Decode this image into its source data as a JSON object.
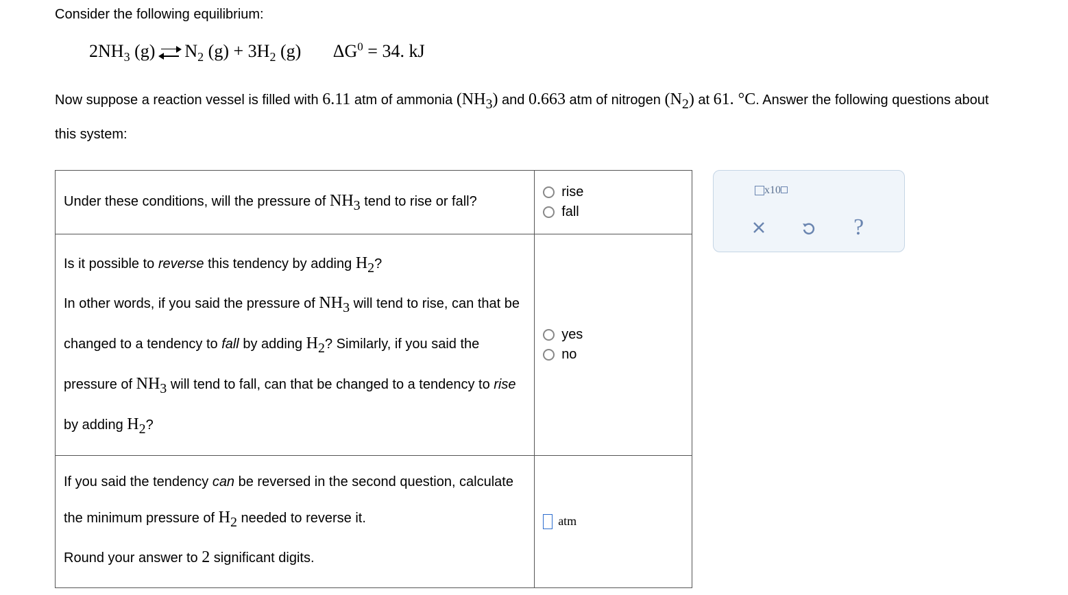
{
  "intro_text": "Consider the following equilibrium:",
  "equation": {
    "left": "2NH",
    "left_sub": "3",
    "left_state": "(g)",
    "product1": "N",
    "product1_sub": "2",
    "product1_state": "(g)",
    "plus": "+",
    "product2": "3H",
    "product2_sub": "2",
    "product2_state": "(g)",
    "delta_g_label": "ΔG",
    "delta_g_sup": "0",
    "delta_g_value": "= 34. kJ"
  },
  "problem": {
    "prefix": "Now suppose a reaction vessel is filled with ",
    "val1": "6.11",
    "text1": " atm of ammonia ",
    "species1": "(NH",
    "species1_sub": "3",
    "species1_close": ")",
    "text2": " and ",
    "val2": "0.663",
    "text3": " atm of nitrogen ",
    "species2": "(N",
    "species2_sub": "2",
    "species2_close": ")",
    "text4": " at ",
    "temp": "61. °C",
    "text5": ". Answer the following questions about this system:"
  },
  "questions": {
    "q1": {
      "prefix": "Under these conditions, will the pressure of ",
      "species": "NH",
      "species_sub": "3",
      "suffix": " tend to rise or fall?",
      "opt1": "rise",
      "opt2": "fall"
    },
    "q2": {
      "line1_prefix": "Is it possible to ",
      "reverse": "reverse",
      "line1_mid": " this tendency by adding ",
      "h2": "H",
      "h2_sub": "2",
      "q_mark": "?",
      "line2_prefix": "In other words, if you said the pressure of ",
      "nh3": "NH",
      "nh3_sub": "3",
      "line2_suffix": " will tend to rise, can that be changed to a tendency to ",
      "fall": "fall",
      "line3_prefix": " by adding ",
      "line3_suffix": "? Similarly, if you said the pressure of ",
      "line4_suffix": " will tend to fall, can that be changed to a tendency to ",
      "rise": "rise",
      "line5_suffix": " by adding ",
      "opt1": "yes",
      "opt2": "no"
    },
    "q3": {
      "line1_prefix": "If you said the tendency ",
      "can": "can",
      "line1_suffix": " be reversed in the second question, calculate the minimum pressure of ",
      "h2": "H",
      "h2_sub": "2",
      "line2": " needed to reverse it.",
      "line3_prefix": "Round your answer to ",
      "sig": "2",
      "line3_suffix": " significant digits.",
      "unit": "atm"
    }
  },
  "toolbox": {
    "x10": "x10"
  }
}
